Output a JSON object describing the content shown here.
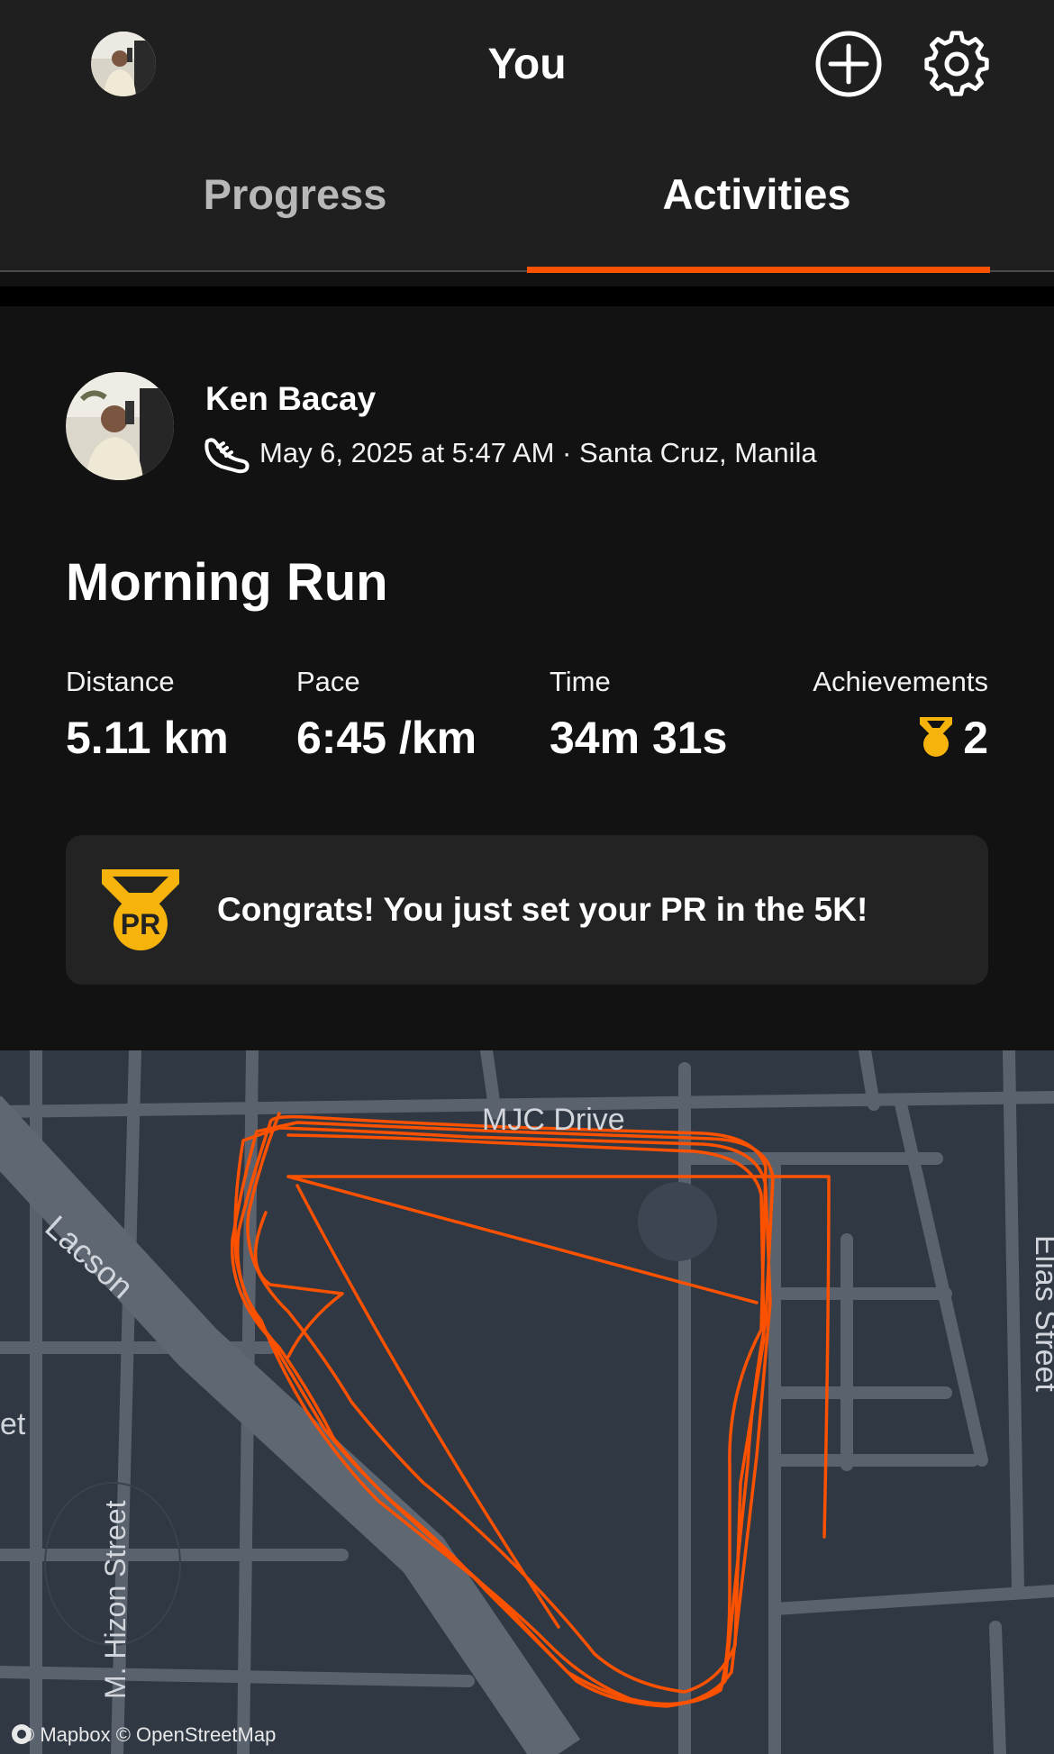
{
  "header": {
    "title": "You"
  },
  "tabs": [
    {
      "label": "Progress",
      "active": false
    },
    {
      "label": "Activities",
      "active": true
    }
  ],
  "activity": {
    "athlete_name": "Ken Bacay",
    "meta": "May 6, 2025 at 5:47 AM · Santa Cruz, Manila",
    "title": "Morning Run",
    "stats": [
      {
        "label": "Distance",
        "value": "5.11 km"
      },
      {
        "label": "Pace",
        "value": "6:45 /km"
      },
      {
        "label": "Time",
        "value": "34m 31s"
      },
      {
        "label": "Achievements",
        "value": "2"
      }
    ],
    "pr_message": "Congrats! You just set your PR in the 5K!",
    "pr_badge_text": "PR"
  },
  "map": {
    "street_labels": [
      "Lacson",
      "MJC Drive",
      "Elias Street",
      "M. Hizon Street",
      "et"
    ],
    "attribution": "© Mapbox © OpenStreetMap"
  },
  "colors": {
    "accent": "#fc5200",
    "gold": "#f5b30b",
    "background": "#121212",
    "header_bg": "#1f1f1f"
  },
  "icons": [
    "add-activity-icon",
    "settings-gear-icon",
    "run-shoe-icon",
    "medal-icon",
    "pr-medal-icon",
    "mapbox-logo-icon"
  ]
}
